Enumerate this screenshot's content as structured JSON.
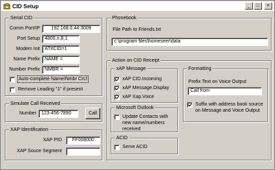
{
  "window": {
    "title": "CID Setup",
    "minimize": "_",
    "maximize": "□",
    "close": "×"
  },
  "serial": {
    "legend": "Serial CID",
    "comm_label": "Comm Port/IP",
    "comm_value": "192.168.0.44:3009",
    "port_setup_label": "Port Setup",
    "port_setup_value": "4800,n,8,1",
    "modem_init_label": "Modem Init",
    "modem_init_value": "AT#CID=1",
    "name_prefix_label": "Name Prefix",
    "name_prefix_value": "NAME =",
    "number_prefix_label": "Number Prefix",
    "number_prefix_value": "NMBR =",
    "autocomplete_label": "Auto-complete Name/Nmbr CrLf",
    "remove_leading_label": "Remove Leading \"1\" if present"
  },
  "simulate": {
    "legend": "Simulate Call Received",
    "number_label": "Number",
    "number_value": "123-456-7890",
    "call_label": "Call"
  },
  "xap_id": {
    "legend": "XAP Identification",
    "pid_label": "XAP PID",
    "pid_value": "FF008000",
    "source_label": "XAP Souce Segment",
    "source_value": ""
  },
  "phonebook": {
    "legend": "Phonebook",
    "path_label": "File Path to Friends.txt",
    "path_value": "c:\\program files\\homeseer\\data"
  },
  "action": {
    "legend": "Action on CID Receipt",
    "xap": {
      "legend": "xAP Message",
      "items": [
        {
          "label": "xAP CID.Incoming",
          "checked": true
        },
        {
          "label": "xAP Message.Display",
          "checked": true
        },
        {
          "label": "xAP Xap.Voice",
          "checked": true
        }
      ]
    },
    "outlook": {
      "legend": "Microsoft Outlook",
      "update_label": "Update Contacts with new name/numbers received"
    },
    "acid": {
      "legend": "ACID",
      "serve_label": "Serve ACID"
    },
    "formatting": {
      "legend": "Formatting",
      "prefix_label": "Prefix Text on Voice Output",
      "prefix_value": "Call from",
      "suffix_label": "Suffix with address book source on Message and Voice Output"
    }
  }
}
